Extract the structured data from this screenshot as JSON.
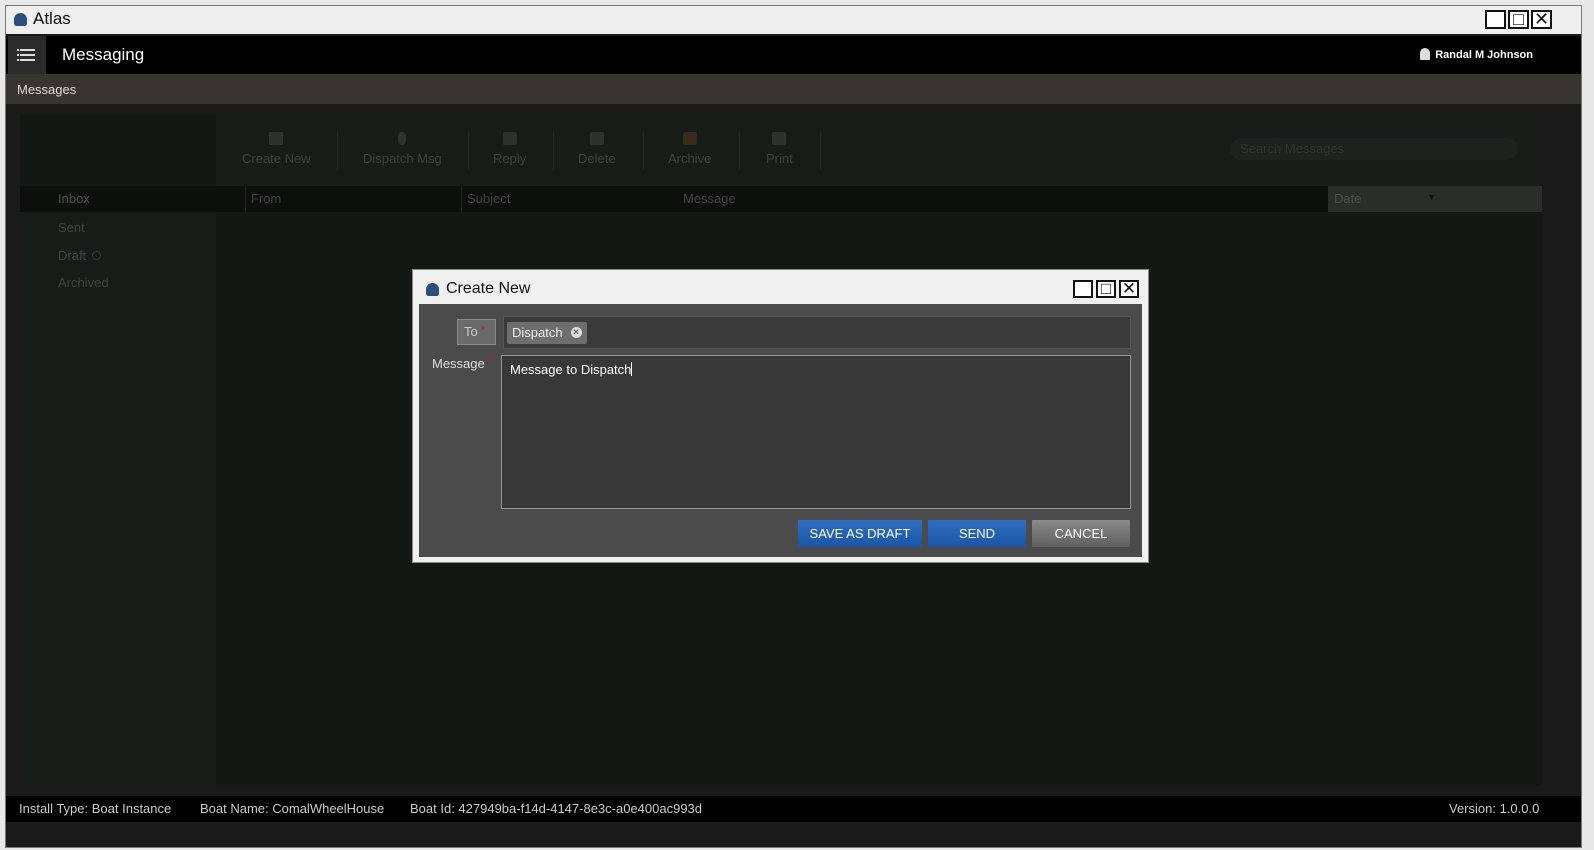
{
  "window": {
    "title": "Atlas"
  },
  "header": {
    "title": "Messaging",
    "user": "Randal M Johnson"
  },
  "breadcrumb": "Messages",
  "toolbar": {
    "create_new": "Create New",
    "dispatch_msg": "Dispatch Msg",
    "reply": "Reply",
    "delete": "Delete",
    "archive": "Archive",
    "print": "Print",
    "search_placeholder": "Search Messages"
  },
  "sidebar": {
    "items": [
      {
        "label": "Inbox"
      },
      {
        "label": "Sent"
      },
      {
        "label": "Draft"
      },
      {
        "label": "Archived"
      }
    ]
  },
  "table": {
    "columns": [
      "From",
      "Subject",
      "Message",
      "Date"
    ]
  },
  "dialog": {
    "title": "Create New",
    "to_label": "To",
    "to_recipient": "Dispatch",
    "message_label": "Message",
    "message_value": "Message to Dispatch",
    "save_draft": "SAVE AS DRAFT",
    "send": "SEND",
    "cancel": "CANCEL"
  },
  "status": {
    "install_type": "Install Type:  Boat Instance",
    "boat_name": "Boat Name:  ComalWheelHouse",
    "boat_id": "Boat Id:  427949ba-f14d-4147-8e3c-a0e400ac993d",
    "version": "Version:  1.0.0.0"
  }
}
